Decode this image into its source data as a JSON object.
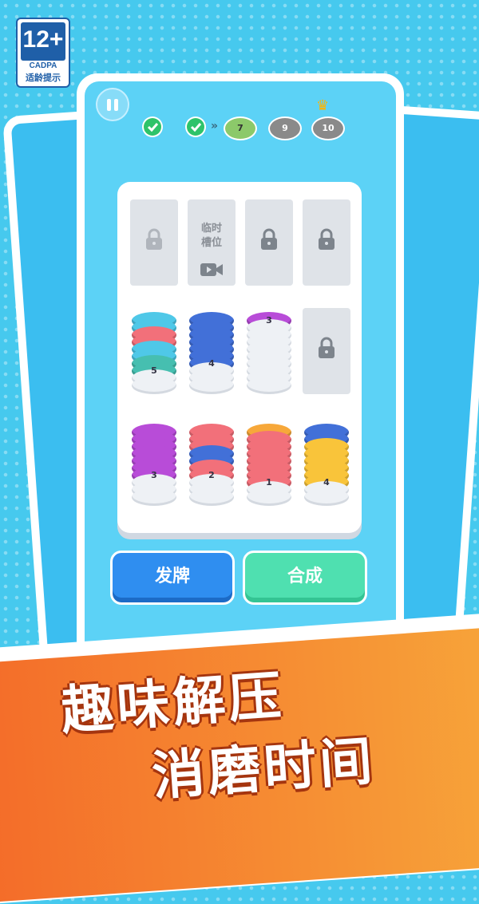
{
  "age_rating": {
    "number": "12+",
    "org": "CADPA",
    "tip": "适龄提示"
  },
  "header": {
    "levels": [
      {
        "state": "done"
      },
      {
        "state": "done"
      },
      {
        "label": "7",
        "state": "current",
        "color": "#8cc96a"
      },
      {
        "label": "9",
        "state": "upcoming",
        "color": "#8a8a8a"
      },
      {
        "label": "10",
        "state": "boss",
        "color": "#8a8a8a"
      }
    ]
  },
  "temp_slot": {
    "label": "临时\n槽位"
  },
  "stacks": [
    {
      "label": "5",
      "colors": [
        "#4fc8e8",
        "#4fc8e8",
        "#f2707a",
        "#f2707a",
        "#4fc8e8",
        "#4fc8e8",
        "#46bfb0",
        "#46bfb0"
      ]
    },
    {
      "label": "4",
      "colors": [
        "#4270d8",
        "#4270d8",
        "#4270d8",
        "#4270d8",
        "#4270d8",
        "#4270d8",
        "#4270d8"
      ]
    },
    {
      "label": "3",
      "colors": [
        "#b84cd8"
      ]
    },
    {
      "label": "3",
      "colors": [
        "#b84cd8",
        "#b84cd8",
        "#b84cd8",
        "#b84cd8",
        "#b84cd8",
        "#b84cd8",
        "#b84cd8"
      ]
    },
    {
      "label": "2",
      "colors": [
        "#f2707a",
        "#f2707a",
        "#f2707a",
        "#4270d8",
        "#4270d8",
        "#f2707a",
        "#f2707a"
      ]
    },
    {
      "label": "1",
      "colors": [
        "#f7a83a",
        "#f2707a",
        "#f2707a",
        "#f2707a",
        "#f2707a",
        "#f2707a",
        "#f2707a",
        "#f2707a"
      ]
    },
    {
      "label": "4",
      "colors": [
        "#4270d8",
        "#4270d8",
        "#f9c43a",
        "#f9c43a",
        "#f9c43a",
        "#f9c43a",
        "#f9c43a",
        "#f9c43a"
      ]
    }
  ],
  "buttons": {
    "deal": "发牌",
    "merge": "合成"
  },
  "slogan": {
    "line1": "趣味解压",
    "line2": "消磨时间"
  }
}
